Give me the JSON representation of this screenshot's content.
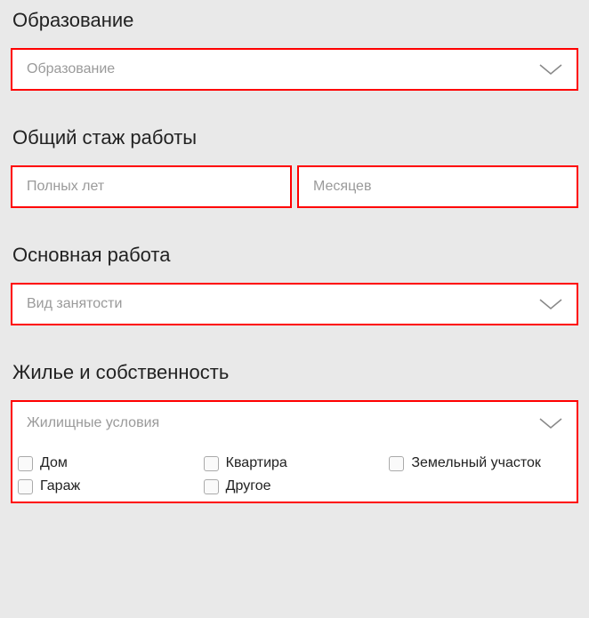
{
  "education": {
    "title": "Образование",
    "placeholder": "Образование"
  },
  "experience": {
    "title": "Общий стаж работы",
    "years_placeholder": "Полных лет",
    "months_placeholder": "Месяцев"
  },
  "main_job": {
    "title": "Основная работа",
    "placeholder": "Вид занятости"
  },
  "housing": {
    "title": "Жилье и собственность",
    "placeholder": "Жилищные условия",
    "options": {
      "house": "Дом",
      "apartment": "Квартира",
      "land": "Земельный участок",
      "garage": "Гараж",
      "other": "Другое"
    }
  }
}
